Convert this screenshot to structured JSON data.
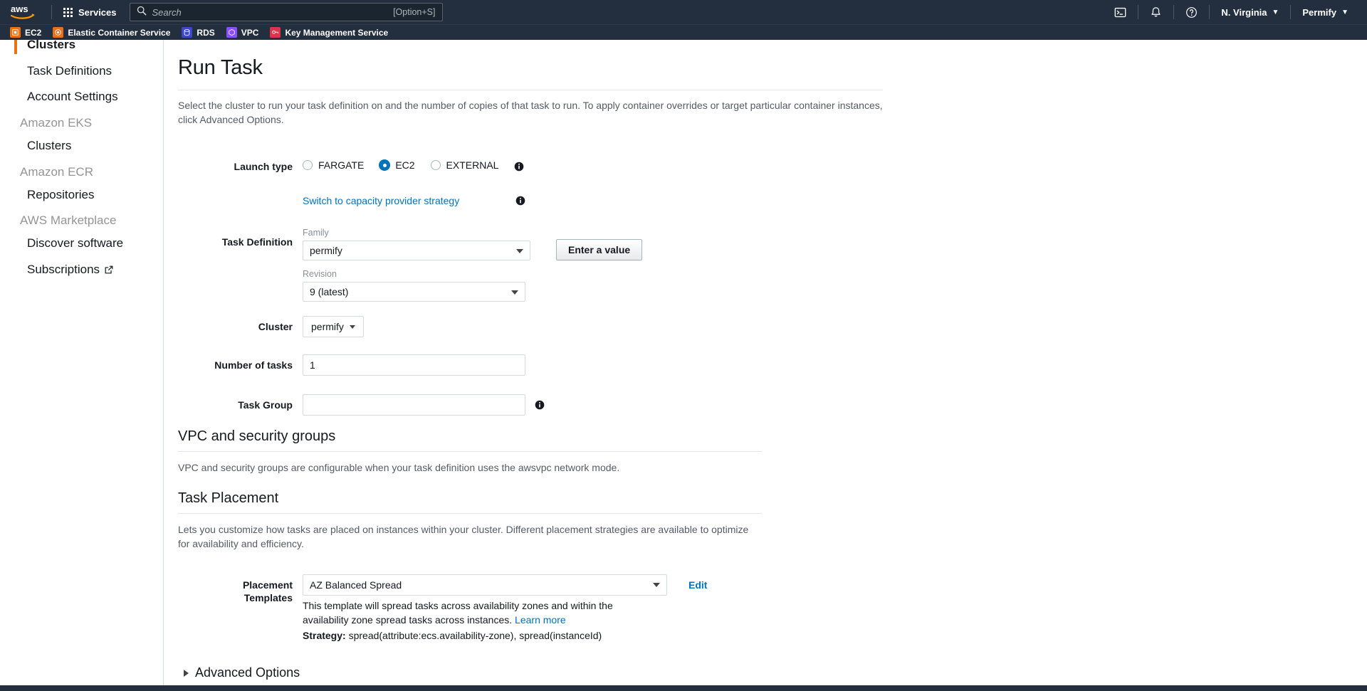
{
  "topnav": {
    "logo_alt": "aws",
    "services_label": "Services",
    "search_placeholder": "Search",
    "search_value": "",
    "search_shortcut": "[Option+S]",
    "cloudshell_icon": "cloudshell-icon",
    "notifications_icon": "bell-icon",
    "help_icon": "help-icon",
    "region_label": "N. Virginia",
    "account_label": "Permify"
  },
  "favorites": [
    {
      "label": "EC2",
      "color": "#ec7211",
      "icon": "ec2-icon"
    },
    {
      "label": "Elastic Container Service",
      "color": "#e7711b",
      "icon": "ecs-icon"
    },
    {
      "label": "RDS",
      "color": "#3b48cc",
      "icon": "rds-icon"
    },
    {
      "label": "VPC",
      "color": "#8c4fff",
      "icon": "vpc-icon"
    },
    {
      "label": "Key Management Service",
      "color": "#dd344c",
      "icon": "kms-icon"
    }
  ],
  "sidebar": {
    "items": [
      {
        "type": "link",
        "label": "Clusters",
        "active": true
      },
      {
        "type": "link",
        "label": "Task Definitions",
        "active": false
      },
      {
        "type": "link",
        "label": "Account Settings",
        "active": false
      },
      {
        "type": "group",
        "label": "Amazon EKS"
      },
      {
        "type": "link",
        "label": "Clusters",
        "active": false
      },
      {
        "type": "group",
        "label": "Amazon ECR"
      },
      {
        "type": "link",
        "label": "Repositories",
        "active": false
      },
      {
        "type": "group",
        "label": "AWS Marketplace"
      },
      {
        "type": "link",
        "label": "Discover software",
        "active": false
      },
      {
        "type": "link",
        "label": "Subscriptions",
        "active": false,
        "external": true
      }
    ]
  },
  "main": {
    "title": "Run Task",
    "lead": "Select the cluster to run your task definition on and the number of copies of that task to run. To apply container overrides or target particular container instances, click Advanced Options.",
    "launch_type": {
      "label": "Launch type",
      "options": [
        {
          "label": "FARGATE",
          "checked": false
        },
        {
          "label": "EC2",
          "checked": true
        },
        {
          "label": "EXTERNAL",
          "checked": false
        }
      ]
    },
    "capacity_provider_link": "Switch to capacity provider strategy",
    "task_definition": {
      "label": "Task Definition",
      "family_sublabel": "Family",
      "family_value": "permify",
      "revision_sublabel": "Revision",
      "revision_value": "9 (latest)",
      "enter_value_button": "Enter a value"
    },
    "cluster": {
      "label": "Cluster",
      "value": "permify"
    },
    "number_of_tasks": {
      "label": "Number of tasks",
      "value": "1"
    },
    "task_group": {
      "label": "Task Group",
      "value": "",
      "placeholder": ""
    },
    "vpc_section": {
      "title": "VPC and security groups",
      "description": "VPC and security groups are configurable when your task definition uses the awsvpc network mode."
    },
    "placement_section": {
      "title": "Task Placement",
      "description": "Lets you customize how tasks are placed on instances within your cluster. Different placement strategies are available to optimize for availability and efficiency.",
      "templates_label_line1": "Placement",
      "templates_label_line2": "Templates",
      "template_value": "AZ Balanced Spread",
      "edit_label": "Edit",
      "helper_text": "This template will spread tasks across availability zones and within the availability zone spread tasks across instances.",
      "learn_more": "Learn more",
      "strategy_label": "Strategy:",
      "strategy_value": "spread(attribute:ecs.availability-zone), spread(instanceId)"
    },
    "advanced_options": "Advanced Options"
  }
}
